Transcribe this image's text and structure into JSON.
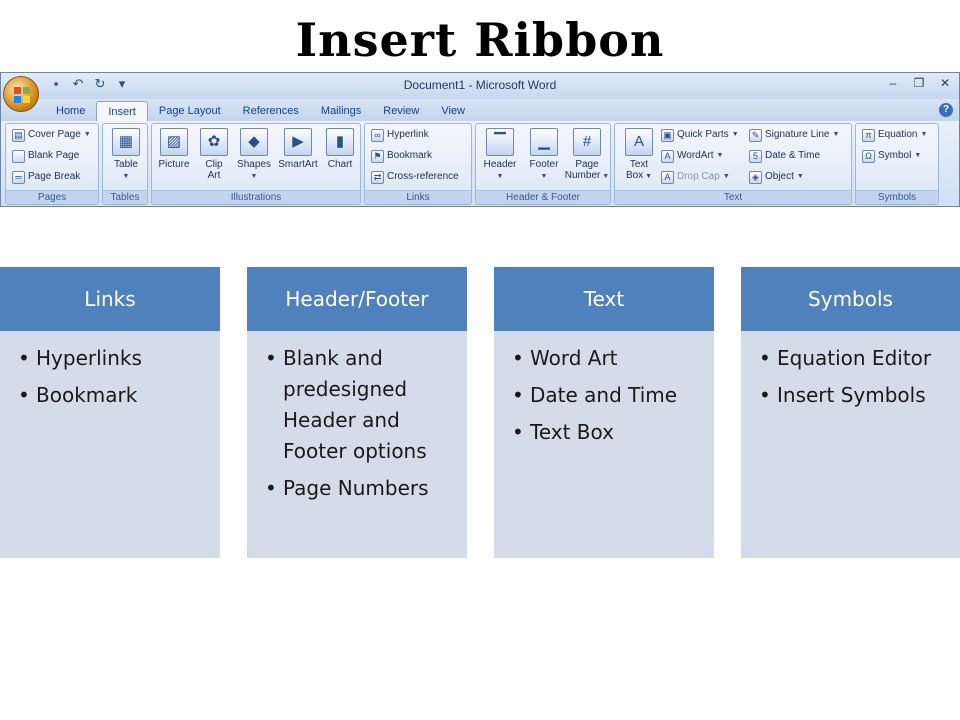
{
  "slide": {
    "title": "Insert Ribbon"
  },
  "window": {
    "title": "Document1 - Microsoft Word",
    "tabs": [
      "Home",
      "Insert",
      "Page Layout",
      "References",
      "Mailings",
      "Review",
      "View"
    ],
    "active_tab": "Insert"
  },
  "ribbon": {
    "pages": {
      "label": "Pages",
      "cover_page": "Cover Page",
      "blank_page": "Blank Page",
      "page_break": "Page Break"
    },
    "tables": {
      "label": "Tables",
      "table": "Table"
    },
    "illustrations": {
      "label": "Illustrations",
      "picture": "Picture",
      "clip_art_1": "Clip",
      "clip_art_2": "Art",
      "shapes": "Shapes",
      "smartart": "SmartArt",
      "chart": "Chart"
    },
    "links": {
      "label": "Links",
      "hyperlink": "Hyperlink",
      "bookmark": "Bookmark",
      "cross_reference": "Cross-reference"
    },
    "header_footer": {
      "label": "Header & Footer",
      "header": "Header",
      "footer": "Footer",
      "page_number_1": "Page",
      "page_number_2": "Number"
    },
    "text": {
      "label": "Text",
      "text_box_1": "Text",
      "text_box_2": "Box",
      "quick_parts": "Quick Parts",
      "wordart": "WordArt",
      "drop_cap": "Drop Cap",
      "signature_line": "Signature Line",
      "date_time": "Date & Time",
      "object": "Object"
    },
    "symbols": {
      "label": "Symbols",
      "equation": "Equation",
      "symbol": "Symbol"
    }
  },
  "cards": [
    {
      "title": "Links",
      "items": [
        "Hyperlinks",
        "Bookmark"
      ]
    },
    {
      "title": "Header/Footer",
      "items": [
        "Blank and predesigned Header and Footer options",
        "Page Numbers"
      ]
    },
    {
      "title": "Text",
      "items": [
        "Word Art",
        "Date and Time",
        "Text Box"
      ]
    },
    {
      "title": "Symbols",
      "items": [
        "Equation Editor",
        "Insert Symbols"
      ]
    }
  ],
  "colors": {
    "card_header": "#4f81bd",
    "card_body": "#d4dcea",
    "ribbon_bg": "#c5d6ec"
  }
}
